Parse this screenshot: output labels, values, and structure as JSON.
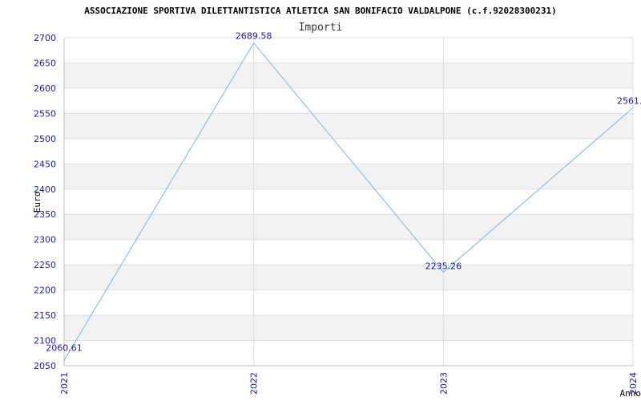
{
  "chart_data": {
    "type": "line",
    "title": "ASSOCIAZIONE SPORTIVA DILETTANTISTICA ATLETICA SAN BONIFACIO VALDALPONE (c.f.92028300231)",
    "subtitle": "Importi",
    "xlabel": "Anno",
    "ylabel": "Euro",
    "categories": [
      "2021",
      "2022",
      "2023",
      "2024"
    ],
    "values": [
      2060.61,
      2689.58,
      2235.26,
      2561.0
    ],
    "value_labels": [
      "2060.61",
      "2689.58",
      "2235.26",
      "2561.0"
    ],
    "y_ticks": [
      "2050",
      "2100",
      "2150",
      "2200",
      "2250",
      "2300",
      "2350",
      "2400",
      "2450",
      "2500",
      "2550",
      "2600",
      "2650",
      "2700"
    ],
    "ylim": [
      2050,
      2700
    ],
    "grid": true,
    "colors": {
      "line": "#7fb2e6",
      "tick_text": "#1a1aa6",
      "band": "#f2f2f2",
      "grid": "#dddddd",
      "axis": "#bbbbbb",
      "title": "#000000",
      "subtitle": "#333333"
    }
  }
}
